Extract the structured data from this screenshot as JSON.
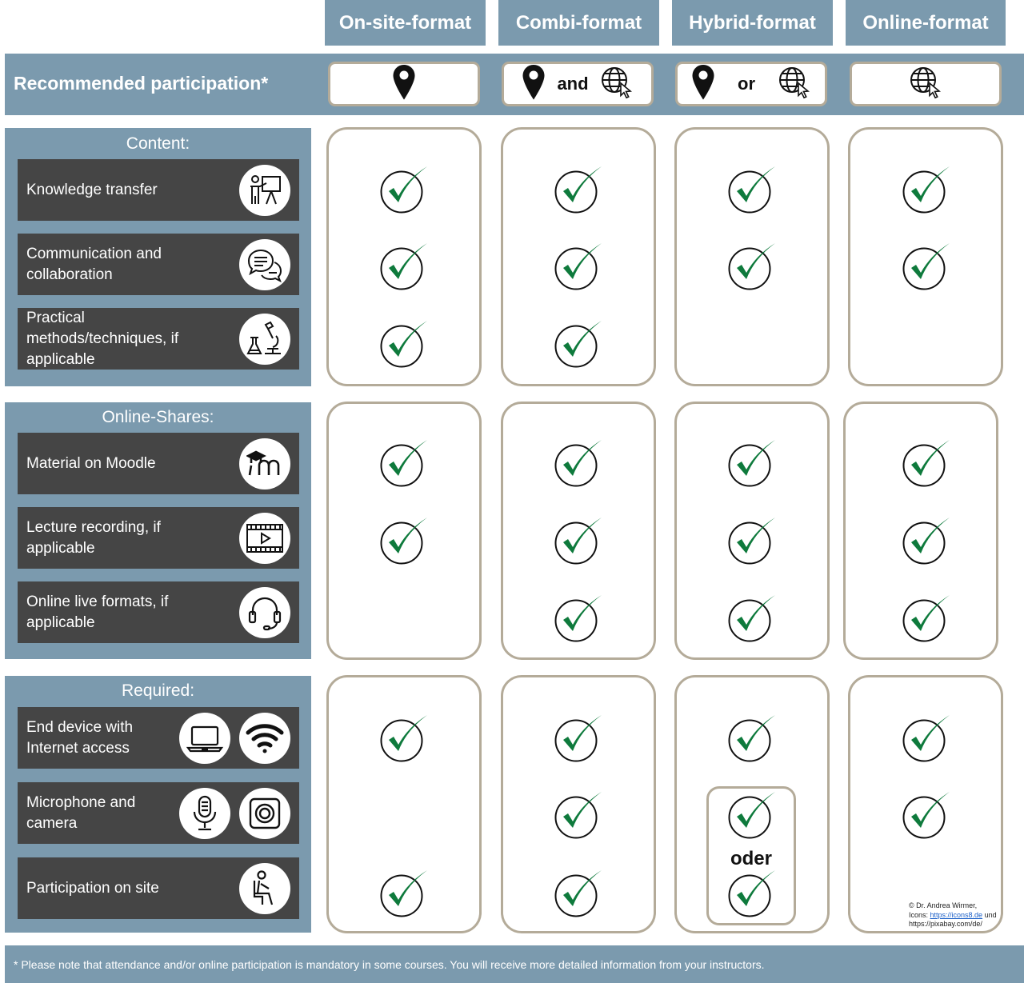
{
  "header": {
    "columns": [
      "On-site-format",
      "Combi-format",
      "Hybrid-format",
      "Online-format"
    ]
  },
  "recommended": {
    "label": "Recommended participation*",
    "connectors": {
      "combi": "and",
      "hybrid": "or"
    },
    "icons": [
      "location-pin-icon",
      "globe-cursor-icon"
    ]
  },
  "sections": {
    "content": {
      "title": "Content:",
      "rows": [
        {
          "label": "Knowledge transfer",
          "icon": "presenter-icon",
          "checks": [
            true,
            true,
            true,
            true
          ]
        },
        {
          "label": "Communication and collaboration",
          "icon": "chat-bubbles-icon",
          "checks": [
            true,
            true,
            true,
            true
          ]
        },
        {
          "label": "Practical methods/techniques, if applicable",
          "icon": "microscope-flask-icon",
          "checks": [
            true,
            true,
            false,
            false
          ]
        }
      ]
    },
    "online": {
      "title": "Online-Shares:",
      "rows": [
        {
          "label": "Material on Moodle",
          "icon": "moodle-icon",
          "checks": [
            true,
            true,
            true,
            true
          ]
        },
        {
          "label": "Lecture recording, if applicable",
          "icon": "video-play-icon",
          "checks": [
            true,
            true,
            true,
            true
          ]
        },
        {
          "label": "Online live formats, if applicable",
          "icon": "headset-icon",
          "checks": [
            false,
            true,
            true,
            true
          ]
        }
      ]
    },
    "required": {
      "title": "Required:",
      "rows": [
        {
          "label": "End device with Internet access",
          "icons": [
            "laptop-icon",
            "wifi-icon"
          ],
          "checks": [
            true,
            true,
            true,
            true
          ]
        },
        {
          "label": "Microphone and camera",
          "icons": [
            "microphone-icon",
            "webcam-icon"
          ],
          "checks": [
            false,
            true,
            true,
            true
          ]
        },
        {
          "label": "Participation on site",
          "icon": "seated-person-icon",
          "checks": [
            true,
            true,
            true,
            false
          ]
        }
      ],
      "hybrid_alternative": "oder"
    }
  },
  "credit": {
    "line1": "© Dr. Andrea Wirmer,",
    "line2_prefix": "Icons: ",
    "line2_link": "https://icons8.de",
    "line2_suffix": " und",
    "line3": "https://pixabay.com/de/"
  },
  "footer": {
    "note": "* Please note that attendance and/or online participation is mandatory in some courses. You will receive more detailed information from your instructors."
  },
  "colors": {
    "panel": "#7b9aae",
    "row": "#454545",
    "border": "#b4ab99",
    "check": "#0e7a3c"
  }
}
